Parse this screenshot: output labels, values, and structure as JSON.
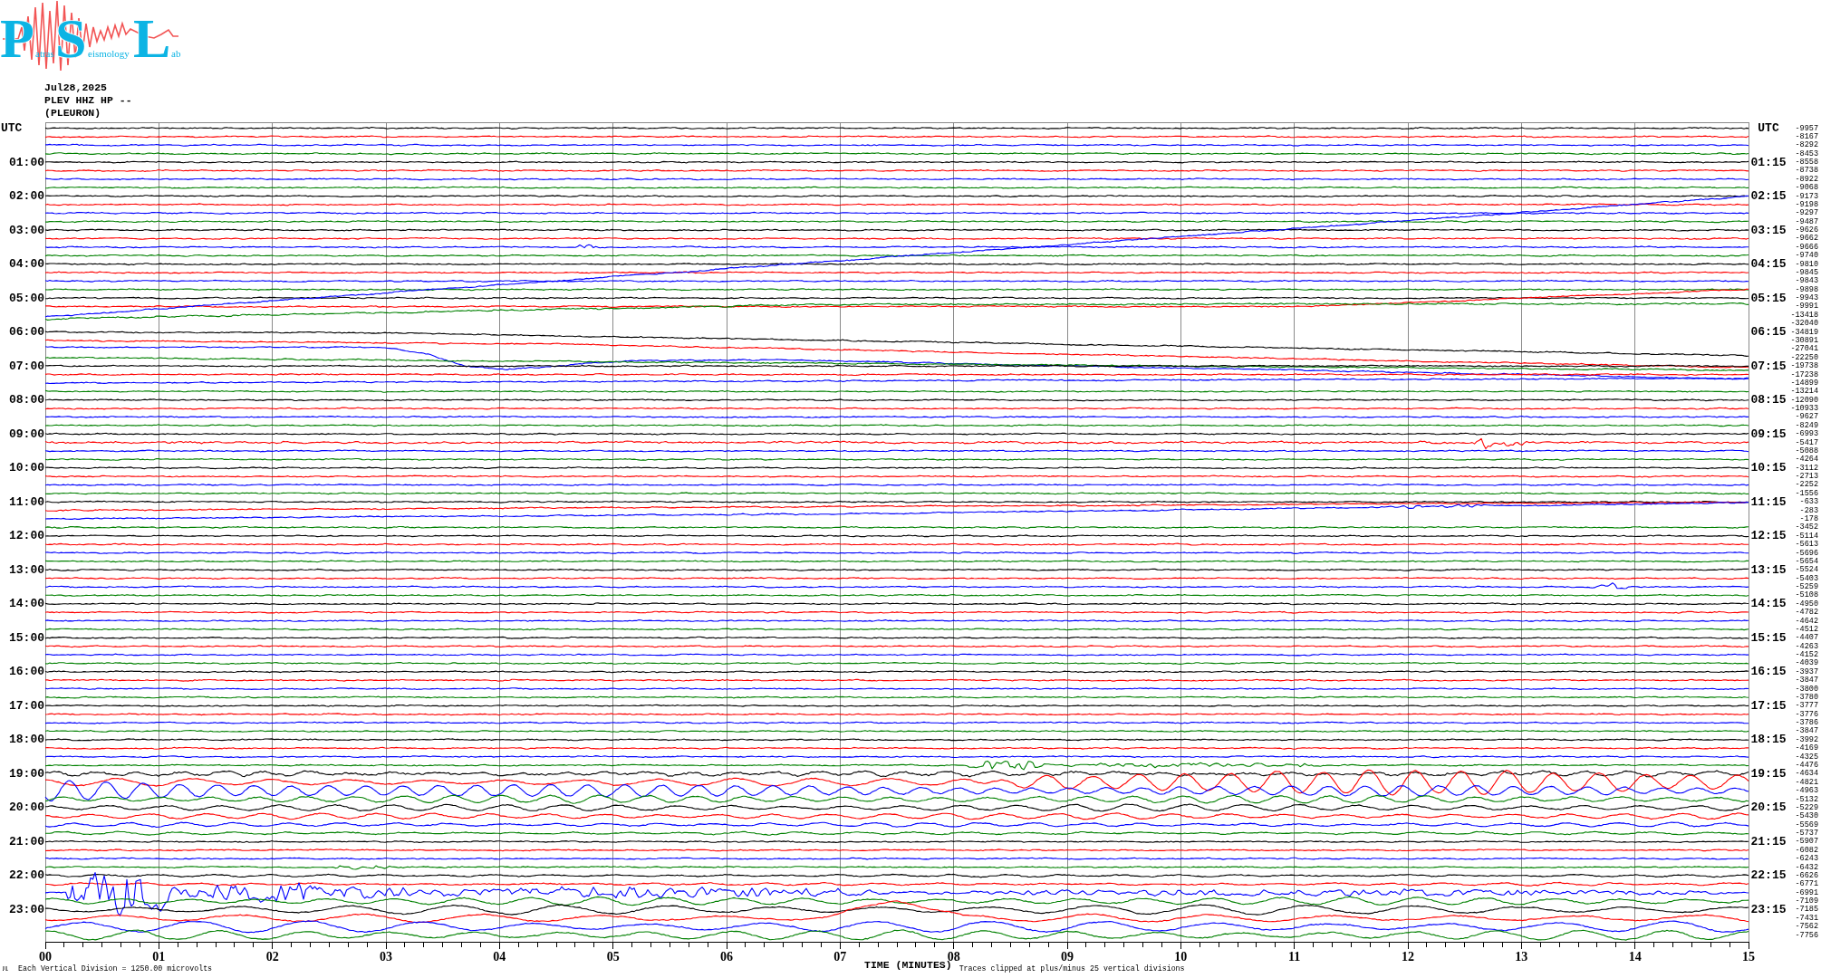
{
  "logo": {
    "parts": [
      {
        "initial": "P",
        "rest": "atras"
      },
      {
        "initial": "S",
        "rest": "eismology"
      },
      {
        "initial": "L",
        "rest": "ab"
      }
    ]
  },
  "header": {
    "date": "Jul28,2025",
    "station": "PLEV HHZ HP --",
    "location": "(PLEURON)"
  },
  "helicorder": {
    "traces": [
      {
        "left_label": "UTC",
        "right_label": "UTC",
        "value": "-9957",
        "color": "#000000"
      },
      {
        "value": "-8167",
        "color": "#ff0000"
      },
      {
        "value": "-8292",
        "color": "#0000ff"
      },
      {
        "value": "-8453",
        "color": "#008000"
      },
      {
        "left_label": "01:00",
        "right_label": "01:15",
        "value": "-8558",
        "color": "#000000"
      },
      {
        "value": "-8738",
        "color": "#ff0000"
      },
      {
        "value": "-8922",
        "color": "#0000ff"
      },
      {
        "value": "-9068",
        "color": "#008000"
      },
      {
        "left_label": "02:00",
        "right_label": "02:15",
        "value": "-9173",
        "color": "#000000"
      },
      {
        "value": "-9198",
        "color": "#ff0000"
      },
      {
        "value": "-9297",
        "color": "#0000ff"
      },
      {
        "value": "-9487",
        "color": "#008000"
      },
      {
        "left_label": "03:00",
        "right_label": "03:15",
        "value": "-9626",
        "color": "#000000"
      },
      {
        "value": "-9662",
        "color": "#ff0000"
      },
      {
        "value": "-9666",
        "color": "#0000ff"
      },
      {
        "value": "-9740",
        "color": "#008000"
      },
      {
        "left_label": "04:00",
        "right_label": "04:15",
        "value": "-9810",
        "color": "#000000"
      },
      {
        "value": "-9845",
        "color": "#ff0000"
      },
      {
        "value": "-9843",
        "color": "#0000ff"
      },
      {
        "value": "-9898",
        "color": "#008000"
      },
      {
        "left_label": "05:00",
        "right_label": "05:15",
        "value": "-9943",
        "color": "#000000"
      },
      {
        "value": "-9991",
        "color": "#ff0000"
      },
      {
        "value": "-13418",
        "color": "#0000ff"
      },
      {
        "value": "-32040",
        "color": "#008000"
      },
      {
        "left_label": "06:00",
        "right_label": "06:15",
        "value": "-34819",
        "color": "#000000"
      },
      {
        "value": "-30891",
        "color": "#ff0000"
      },
      {
        "value": "-27041",
        "color": "#0000ff"
      },
      {
        "value": "-22250",
        "color": "#008000"
      },
      {
        "left_label": "07:00",
        "right_label": "07:15",
        "value": "-19738",
        "color": "#000000"
      },
      {
        "value": "-17238",
        "color": "#ff0000"
      },
      {
        "value": "-14899",
        "color": "#0000ff"
      },
      {
        "value": "-13214",
        "color": "#008000"
      },
      {
        "left_label": "08:00",
        "right_label": "08:15",
        "value": "-12090",
        "color": "#000000"
      },
      {
        "value": "-10933",
        "color": "#ff0000"
      },
      {
        "value": "-9627",
        "color": "#0000ff"
      },
      {
        "value": "-8249",
        "color": "#008000"
      },
      {
        "left_label": "09:00",
        "right_label": "09:15",
        "value": "-6993",
        "color": "#000000"
      },
      {
        "value": "-5417",
        "color": "#ff0000"
      },
      {
        "value": "-5088",
        "color": "#0000ff"
      },
      {
        "value": "-4264",
        "color": "#008000"
      },
      {
        "left_label": "10:00",
        "right_label": "10:15",
        "value": "-3112",
        "color": "#000000"
      },
      {
        "value": "-2713",
        "color": "#ff0000"
      },
      {
        "value": "-2252",
        "color": "#0000ff"
      },
      {
        "value": "-1556",
        "color": "#008000"
      },
      {
        "left_label": "11:00",
        "right_label": "11:15",
        "value": "-633",
        "color": "#000000"
      },
      {
        "value": "-283",
        "color": "#ff0000"
      },
      {
        "value": "-178",
        "color": "#0000ff"
      },
      {
        "value": "-3452",
        "color": "#008000"
      },
      {
        "left_label": "12:00",
        "right_label": "12:15",
        "value": "-5114",
        "color": "#000000"
      },
      {
        "value": "-5613",
        "color": "#ff0000"
      },
      {
        "value": "-5696",
        "color": "#0000ff"
      },
      {
        "value": "-5654",
        "color": "#008000"
      },
      {
        "left_label": "13:00",
        "right_label": "13:15",
        "value": "-5524",
        "color": "#000000"
      },
      {
        "value": "-5403",
        "color": "#ff0000"
      },
      {
        "value": "-5259",
        "color": "#0000ff"
      },
      {
        "value": "-5108",
        "color": "#008000"
      },
      {
        "left_label": "14:00",
        "right_label": "14:15",
        "value": "-4950",
        "color": "#000000"
      },
      {
        "value": "-4782",
        "color": "#ff0000"
      },
      {
        "value": "-4642",
        "color": "#0000ff"
      },
      {
        "value": "-4512",
        "color": "#008000"
      },
      {
        "left_label": "15:00",
        "right_label": "15:15",
        "value": "-4407",
        "color": "#000000"
      },
      {
        "value": "-4263",
        "color": "#ff0000"
      },
      {
        "value": "-4152",
        "color": "#0000ff"
      },
      {
        "value": "-4039",
        "color": "#008000"
      },
      {
        "left_label": "16:00",
        "right_label": "16:15",
        "value": "-3937",
        "color": "#000000"
      },
      {
        "value": "-3847",
        "color": "#ff0000"
      },
      {
        "value": "-3800",
        "color": "#0000ff"
      },
      {
        "value": "-3780",
        "color": "#008000"
      },
      {
        "left_label": "17:00",
        "right_label": "17:15",
        "value": "-3777",
        "color": "#000000"
      },
      {
        "value": "-3776",
        "color": "#ff0000"
      },
      {
        "value": "-3786",
        "color": "#0000ff"
      },
      {
        "value": "-3847",
        "color": "#008000"
      },
      {
        "left_label": "18:00",
        "right_label": "18:15",
        "value": "-3992",
        "color": "#000000"
      },
      {
        "value": "-4169",
        "color": "#ff0000"
      },
      {
        "value": "-4325",
        "color": "#0000ff"
      },
      {
        "value": "-4476",
        "color": "#008000"
      },
      {
        "left_label": "19:00",
        "right_label": "19:15",
        "value": "-4634",
        "color": "#000000"
      },
      {
        "value": "-4821",
        "color": "#ff0000"
      },
      {
        "value": "-4963",
        "color": "#0000ff"
      },
      {
        "value": "-5132",
        "color": "#008000"
      },
      {
        "left_label": "20:00",
        "right_label": "20:15",
        "value": "-5229",
        "color": "#000000"
      },
      {
        "value": "-5430",
        "color": "#ff0000"
      },
      {
        "value": "-5569",
        "color": "#0000ff"
      },
      {
        "value": "-5737",
        "color": "#008000"
      },
      {
        "left_label": "21:00",
        "right_label": "21:15",
        "value": "-5907",
        "color": "#000000"
      },
      {
        "value": "-6082",
        "color": "#ff0000"
      },
      {
        "value": "-6243",
        "color": "#0000ff"
      },
      {
        "value": "-6432",
        "color": "#008000"
      },
      {
        "left_label": "22:00",
        "right_label": "22:15",
        "value": "-6626",
        "color": "#000000"
      },
      {
        "value": "-6771",
        "color": "#ff0000"
      },
      {
        "value": "-6991",
        "color": "#0000ff"
      },
      {
        "value": "-7109",
        "color": "#008000"
      },
      {
        "left_label": "23:00",
        "right_label": "23:15",
        "value": "-7185",
        "color": "#000000"
      },
      {
        "value": "-7431",
        "color": "#ff0000"
      },
      {
        "value": "-7562",
        "color": "#0000ff"
      },
      {
        "value": "-7756",
        "color": "#008000"
      }
    ],
    "x_axis": {
      "ticks": [
        "00",
        "01",
        "02",
        "03",
        "04",
        "05",
        "06",
        "07",
        "08",
        "09",
        "10",
        "11",
        "12",
        "13",
        "14",
        "15"
      ],
      "title": "TIME (MINUTES)"
    }
  },
  "footer": {
    "scale_note": "Each Vertical Division = 1250.00 microvolts",
    "clip_note": "Traces clipped at plus/minus 25 vertical divisions"
  }
}
